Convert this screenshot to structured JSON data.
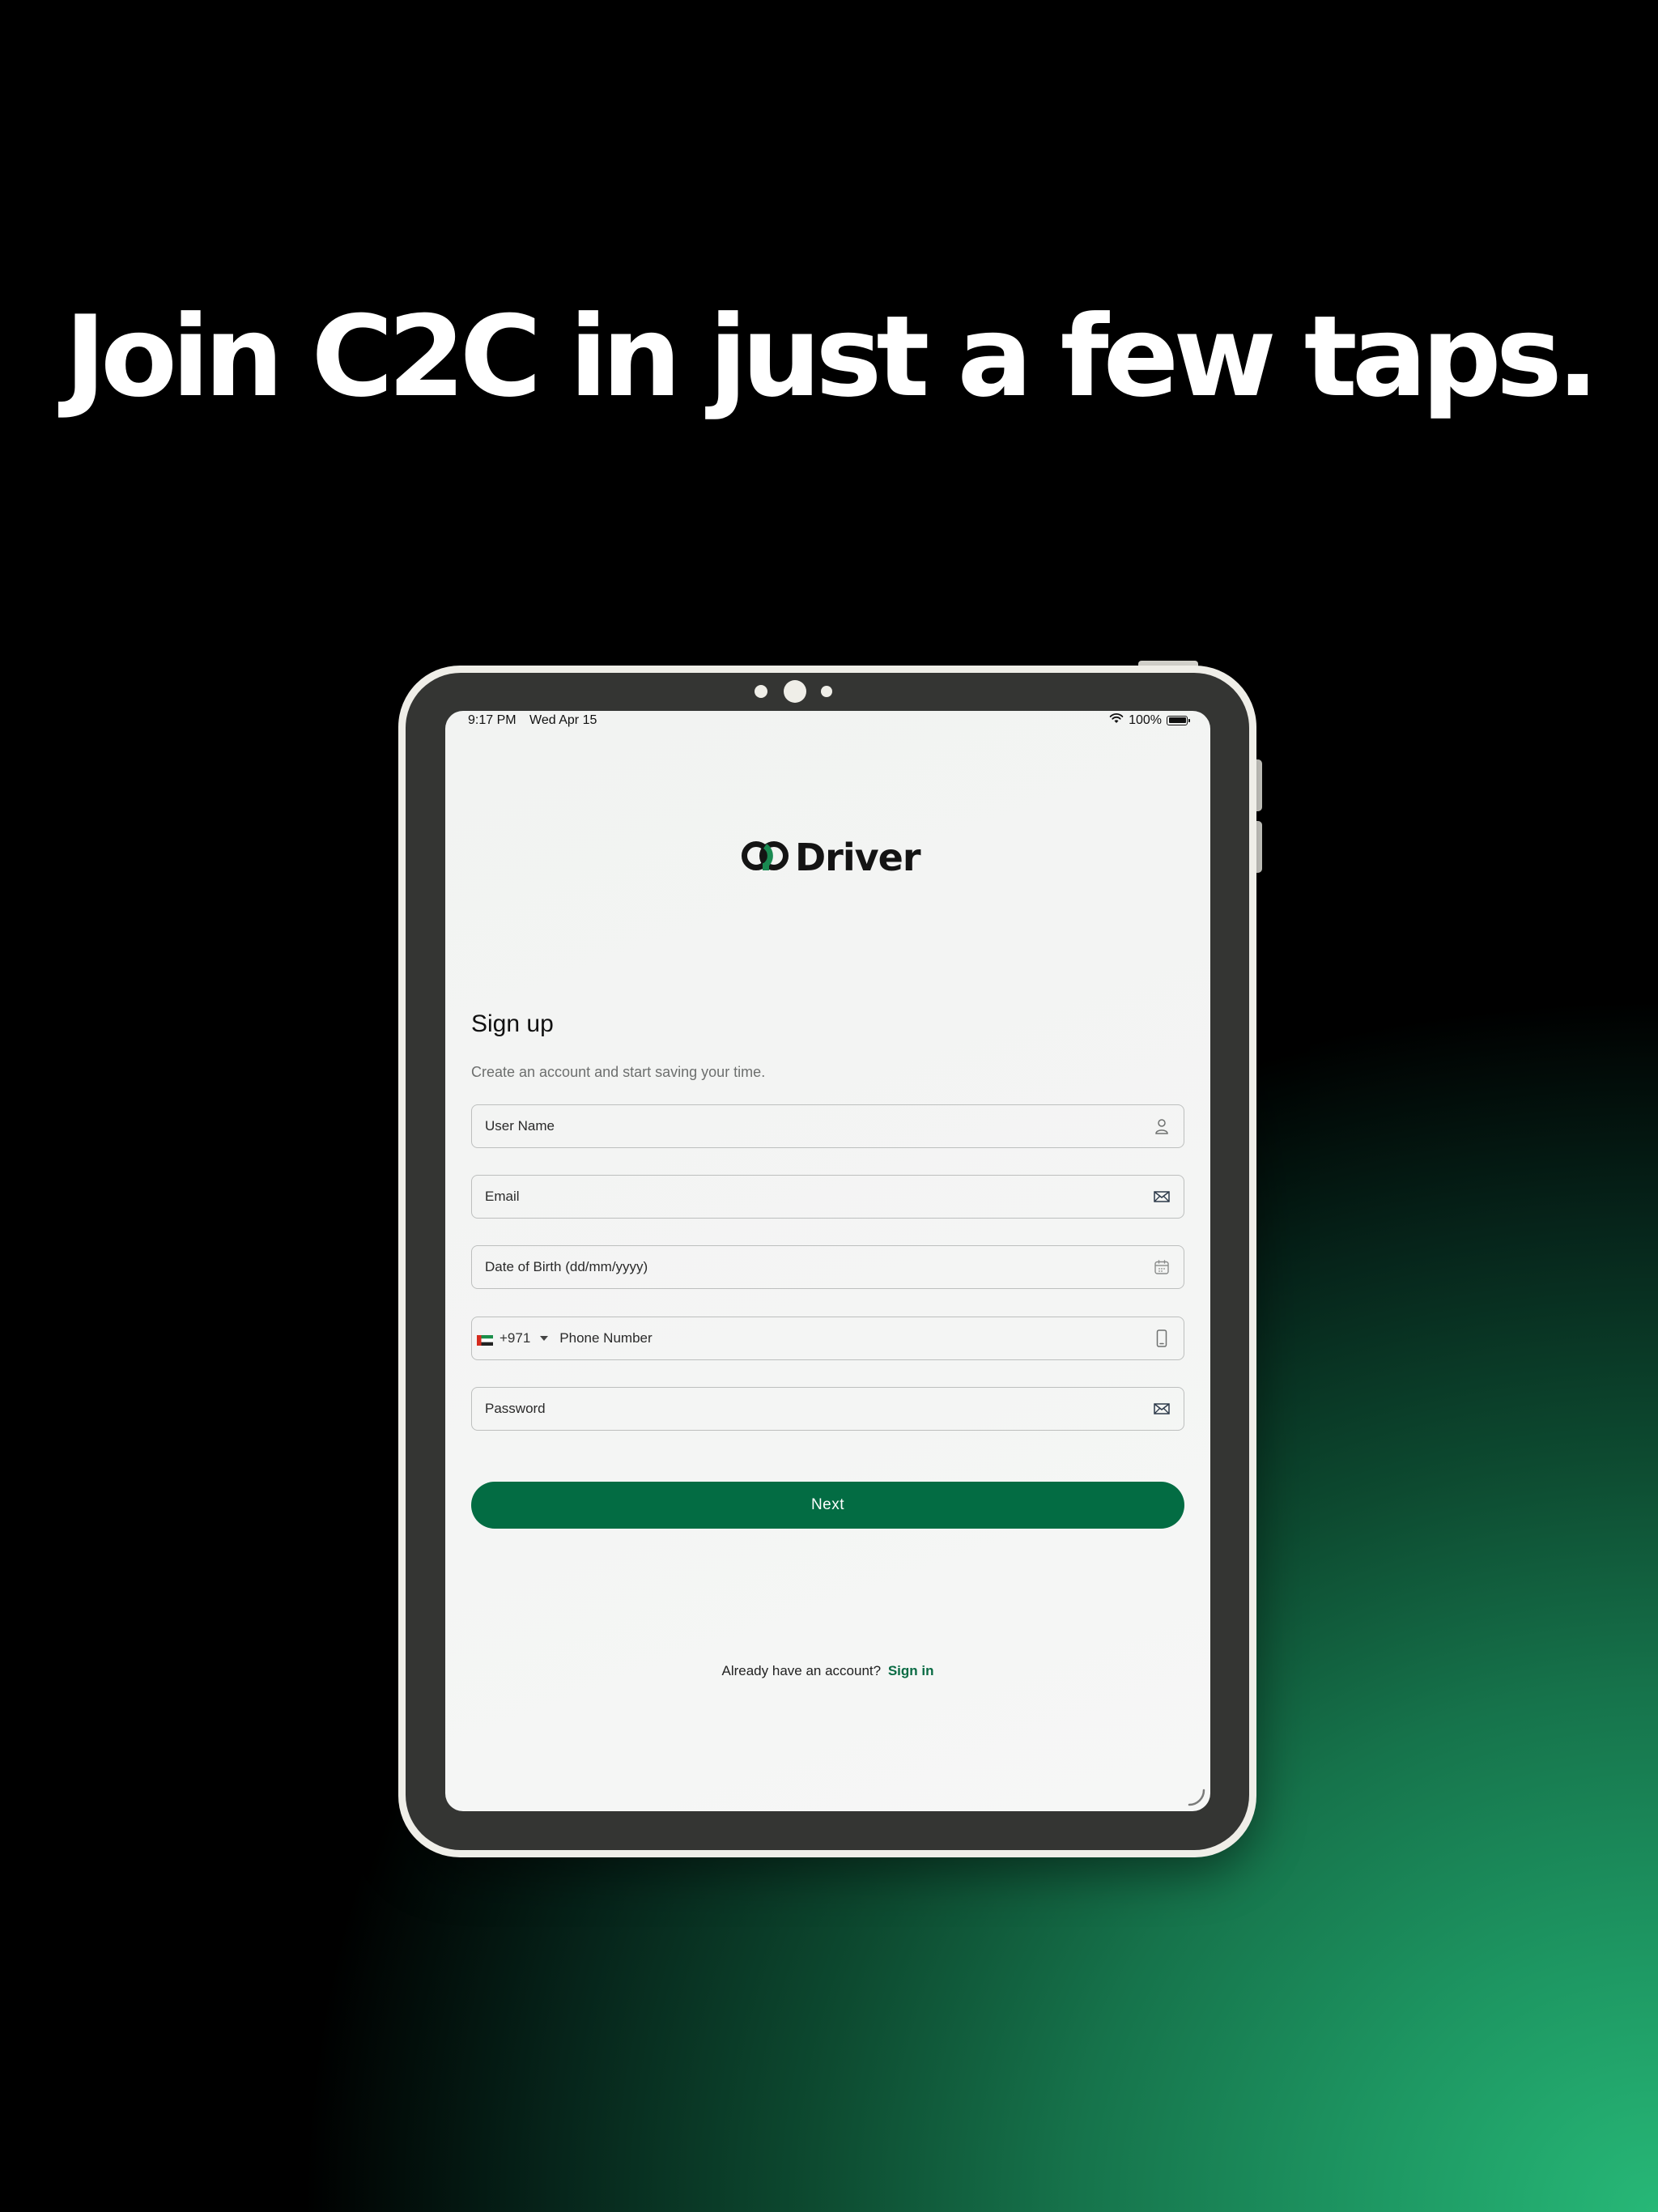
{
  "headline": "Join C2C in just a few taps.",
  "status_bar": {
    "time": "9:17 PM",
    "date": "Wed Apr 15",
    "battery": "100%"
  },
  "brand": {
    "name": "Driver",
    "accent_color": "#0a6b44",
    "logo_colors": [
      "#141414",
      "#1a8a52"
    ]
  },
  "form": {
    "title": "Sign up",
    "subtitle": "Create an account and start saving your time.",
    "username_placeholder": "User Name",
    "email_placeholder": "Email",
    "dob_placeholder": "Date of Birth (dd/mm/yyyy)",
    "country_code": "+971",
    "phone_placeholder": "Phone Number",
    "password_placeholder": "Password",
    "next_label": "Next"
  },
  "footer": {
    "prompt": "Already have an account?",
    "signin_label": "Sign in"
  },
  "icons": {
    "username": "person-icon",
    "email": "envelope-icon",
    "dob": "calendar-icon",
    "phone": "phone-icon",
    "password": "envelope-icon",
    "flag": "uae-flag-icon"
  }
}
